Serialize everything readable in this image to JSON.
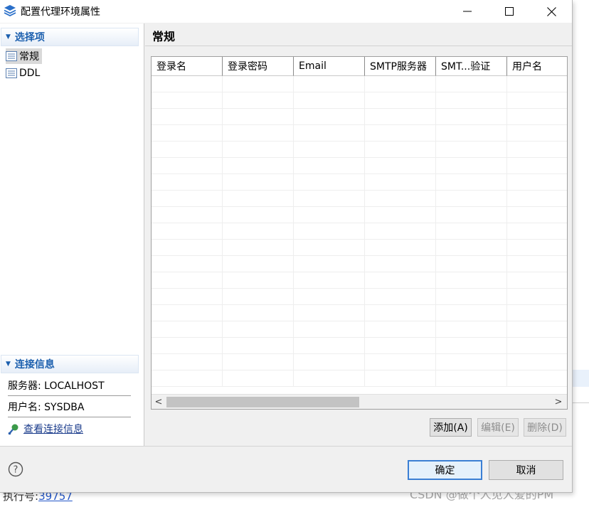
{
  "background": {
    "exec_label": "执行号:",
    "exec_value": "39757",
    "watermark": "CSDN @做个人见人爱的PM"
  },
  "window": {
    "title": "配置代理环境属性",
    "app_icon": "layers-icon",
    "controls": {
      "minimize": "minimize-icon",
      "maximize": "maximize-icon",
      "close": "close-icon"
    }
  },
  "sidebar": {
    "select_section": "选择项",
    "items": [
      {
        "label": "常规",
        "icon": "list-page-icon",
        "selected": true
      },
      {
        "label": "DDL",
        "icon": "list-page-icon",
        "selected": false
      }
    ],
    "connection_section": "连接信息",
    "server": "服务器: LOCALHOST",
    "user": "用户名: SYSDBA",
    "view_link": "查看连接信息",
    "view_link_icon": "connection-icon"
  },
  "main": {
    "title": "常规",
    "table": {
      "columns": [
        "登录名",
        "登录密码",
        "Email",
        "SMTP服务器",
        "SMT...验证",
        "用户名"
      ],
      "rows": []
    },
    "buttons": {
      "add": "添加(A)",
      "edit": "编辑(E)",
      "delete": "删除(D)"
    }
  },
  "footer": {
    "help_icon": "help-icon",
    "ok": "确定",
    "cancel": "取消"
  },
  "colors": {
    "accent": "#1b5fae",
    "ok_border": "#3b7fd4"
  }
}
